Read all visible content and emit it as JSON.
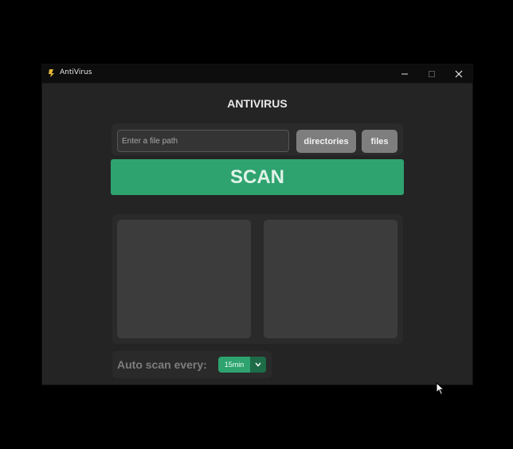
{
  "window": {
    "title": "AntiVirus",
    "icon": "app-icon"
  },
  "main": {
    "heading": "ANTIVIRUS",
    "path_input": {
      "value": "",
      "placeholder": "Enter a file path"
    },
    "directories_button": "directories",
    "files_button": "files",
    "scan_button": "SCAN"
  },
  "auto_scan": {
    "label": "Auto scan every:",
    "selected": "15min"
  },
  "colors": {
    "background": "#242424",
    "accent": "#2ea36f",
    "button_gray": "#7e7e7e"
  }
}
